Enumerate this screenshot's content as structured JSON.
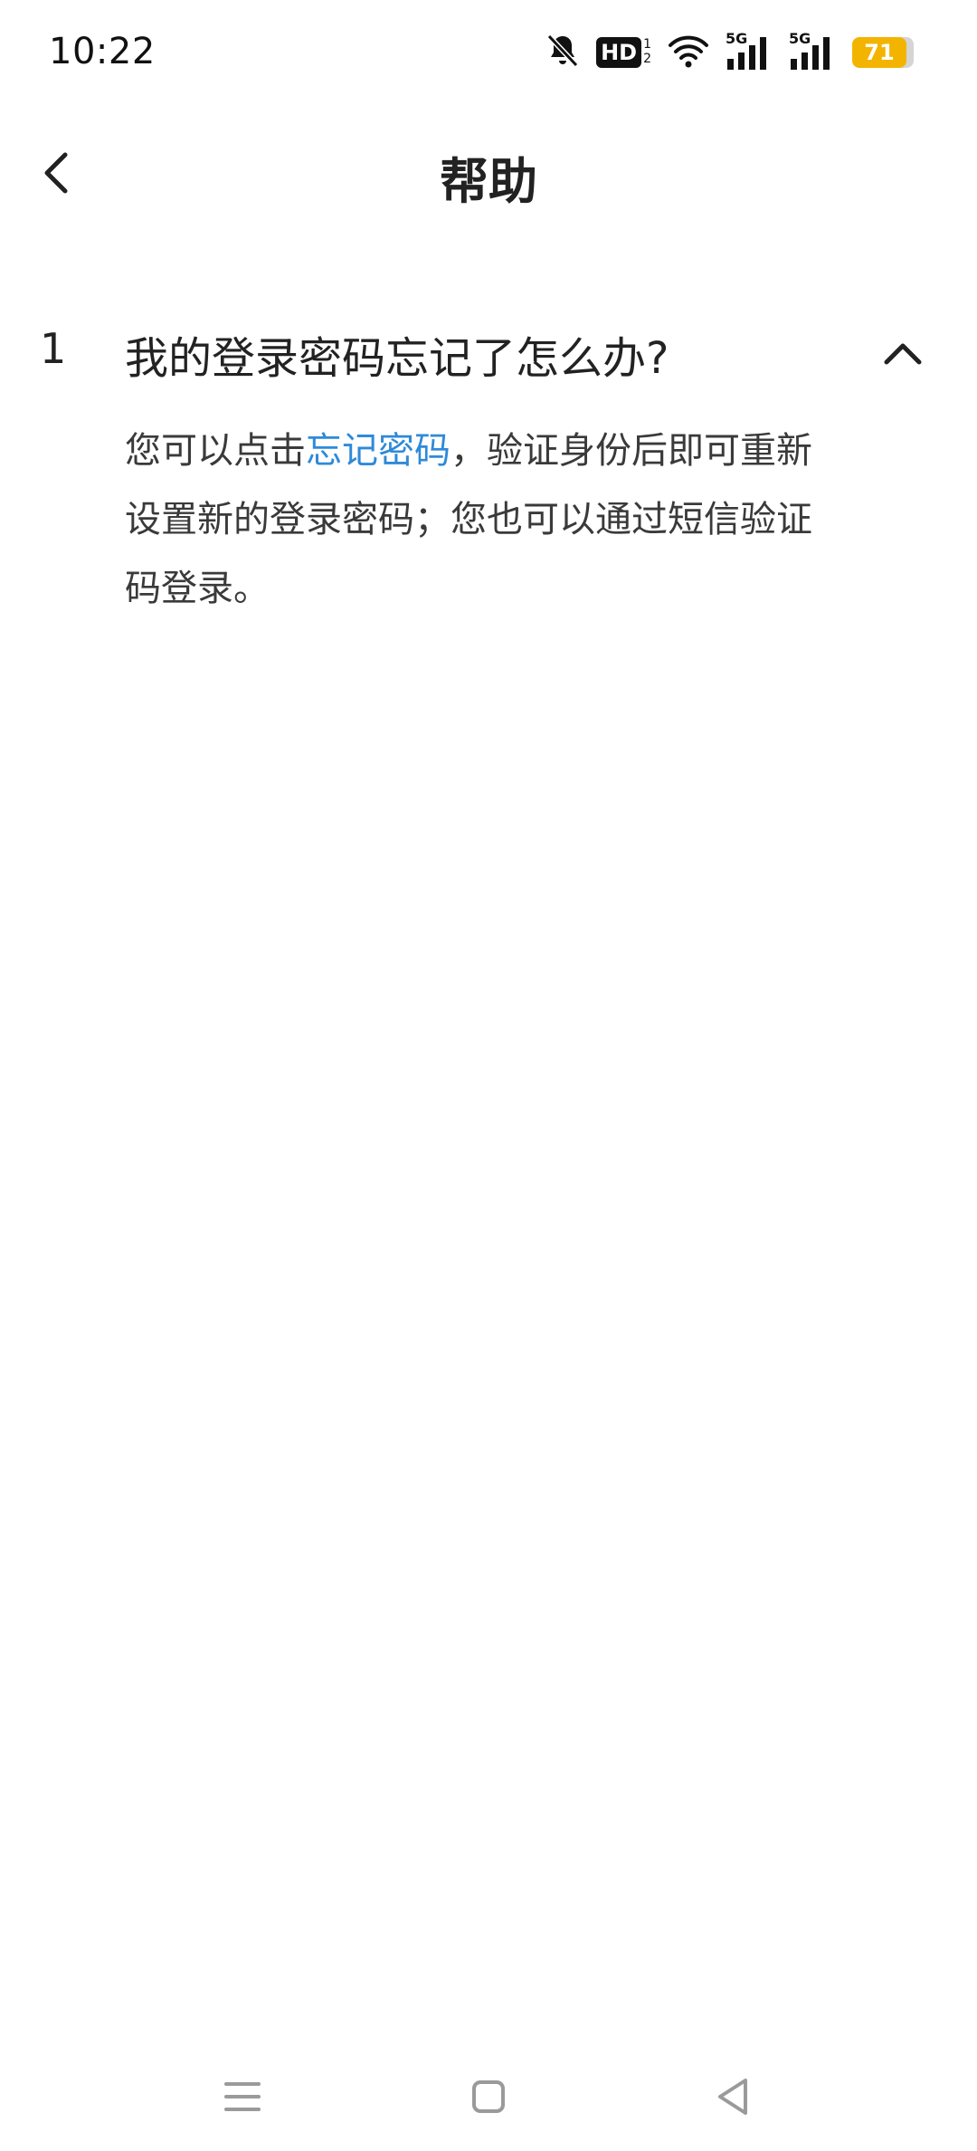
{
  "status_bar": {
    "time": "10:22",
    "hd_label": "HD",
    "hd_sub_1": "1",
    "hd_sub_2": "2",
    "net1_label": "5G",
    "net2_label": "5G",
    "battery_level": "71",
    "battery_color": "#f3b400"
  },
  "header": {
    "title": "帮助"
  },
  "faq": {
    "items": [
      {
        "number": "1",
        "question": "我的登录密码忘记了怎么办?",
        "answer_before_link": "您可以点击",
        "answer_link": "忘记密码",
        "answer_after_link": "，验证身份后即可重新设置新的登录密码；您也可以通过短信验证码登录。"
      }
    ]
  },
  "colors": {
    "link": "#2f8ad8",
    "text": "#222222",
    "nav_icon": "#9a9a9a"
  }
}
